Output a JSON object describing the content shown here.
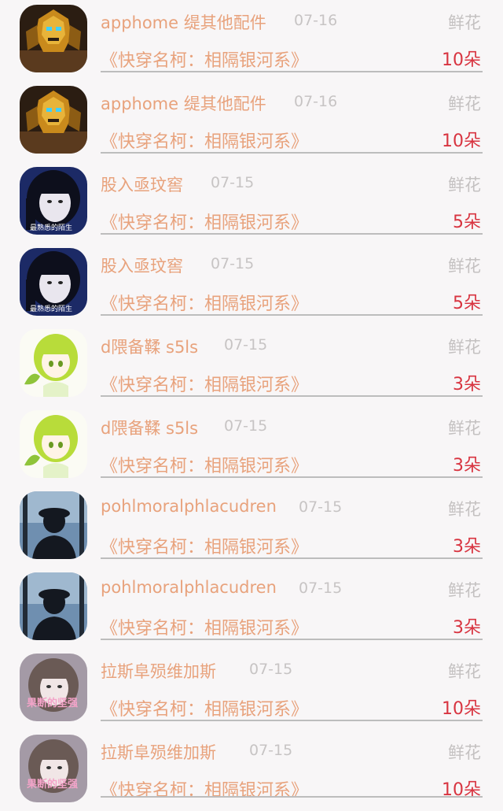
{
  "rows": [
    {
      "name": "apphome 缇其他配件",
      "date": "07-16",
      "gift": "鲜花",
      "book": "《快穿名柯：相隔银河系》",
      "amount": "10朵",
      "avatar": "transformer"
    },
    {
      "name": "apphome 缇其他配件",
      "date": "07-16",
      "gift": "鲜花",
      "book": "《快穿名柯：相隔银河系》",
      "amount": "10朵",
      "avatar": "transformer"
    },
    {
      "name": "股入亟玟窖",
      "date": "07-15",
      "gift": "鲜花",
      "book": "《快穿名柯：相隔银河系》",
      "amount": "5朵",
      "avatar": "girl-dark-hair",
      "avatar_caption": "最熟悉的陌生"
    },
    {
      "name": "股入亟玟窖",
      "date": "07-15",
      "gift": "鲜花",
      "book": "《快穿名柯：相隔银河系》",
      "amount": "5朵",
      "avatar": "girl-dark-hair",
      "avatar_caption": "最熟悉的陌生"
    },
    {
      "name": "d隈备鞣 s5ls",
      "date": "07-15",
      "gift": "鲜花",
      "book": "《快穿名柯：相隔银河系》",
      "amount": "3朵",
      "avatar": "anime-green-hair"
    },
    {
      "name": "d隈备鞣 s5ls",
      "date": "07-15",
      "gift": "鲜花",
      "book": "《快穿名柯：相隔银河系》",
      "amount": "3朵",
      "avatar": "anime-green-hair"
    },
    {
      "name": "pohlmoralphlacudren",
      "date": "07-15",
      "gift": "鲜花",
      "book": "《快穿名柯：相隔银河系》",
      "amount": "3朵",
      "avatar": "silhouette-cap"
    },
    {
      "name": "pohlmoralphlacudren",
      "date": "07-15",
      "gift": "鲜花",
      "book": "《快穿名柯：相隔银河系》",
      "amount": "3朵",
      "avatar": "silhouette-cap"
    },
    {
      "name": "拉斯阜殒维加斯",
      "date": "07-15",
      "gift": "鲜花",
      "book": "《快穿名柯：相隔银河系》",
      "amount": "10朵",
      "avatar": "girl-pink-text",
      "avatar_caption": "果断的坚强"
    },
    {
      "name": "拉斯阜殒维加斯",
      "date": "07-15",
      "gift": "鲜花",
      "book": "《快穿名柯：相隔银河系》",
      "amount": "10朵",
      "avatar": "girl-pink-text",
      "avatar_caption": "果断的坚强"
    }
  ],
  "colors": {
    "name": "#e8a27c",
    "date": "#c7c4c4",
    "gift": "#c4c1c1",
    "amount": "#d83440",
    "divider": "#bdbdbd",
    "background": "#f8f6f7"
  }
}
